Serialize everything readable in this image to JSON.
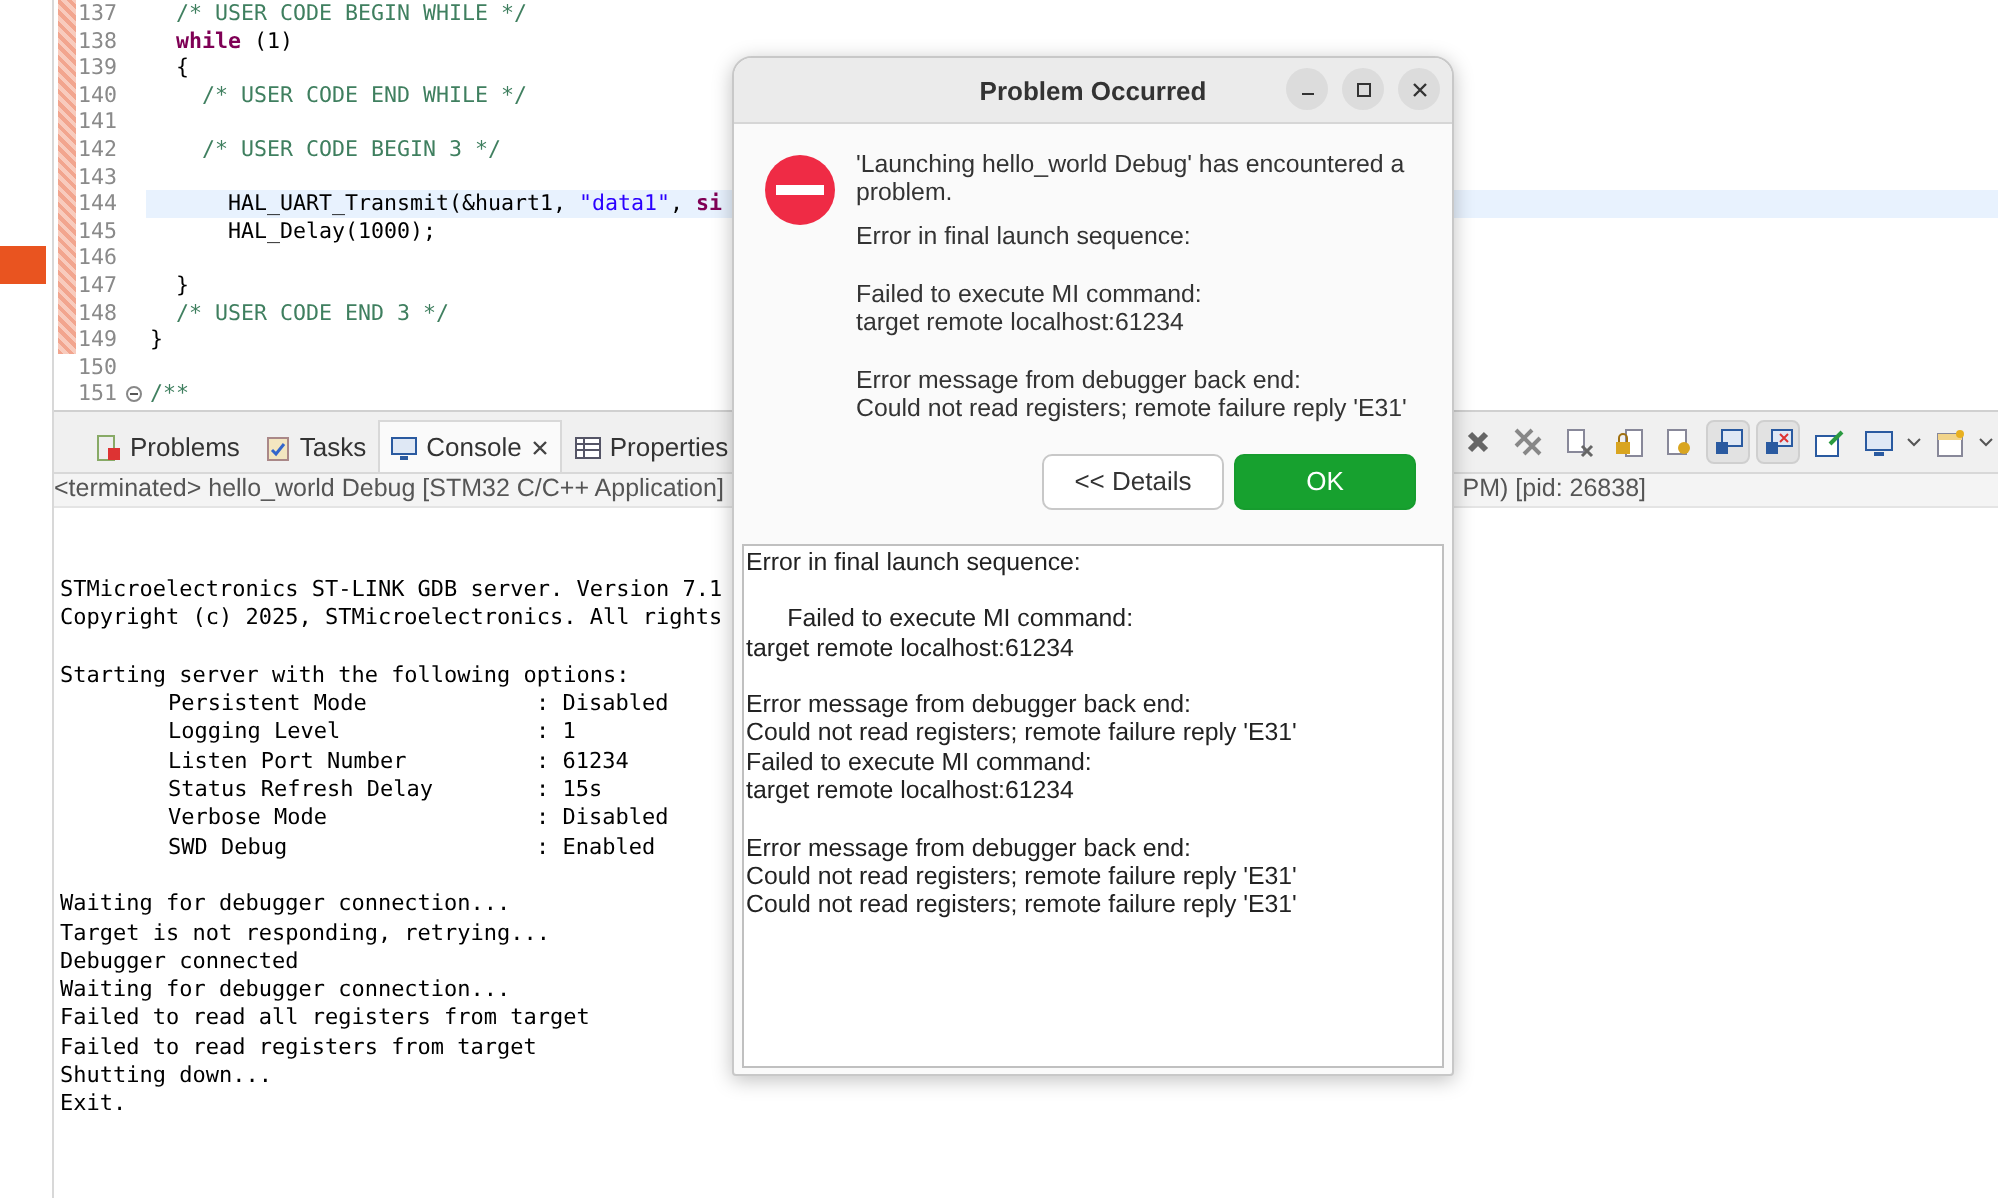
{
  "editor": {
    "lines": [
      {
        "number": "137",
        "current": false,
        "fold": false,
        "segments": [
          {
            "kind": "comment",
            "text": "  /* USER CODE BEGIN WHILE */"
          }
        ]
      },
      {
        "number": "138",
        "current": false,
        "fold": false,
        "segments": [
          {
            "kind": "keyword",
            "text": "  while"
          },
          {
            "kind": "plain",
            "text": " (1)"
          }
        ]
      },
      {
        "number": "139",
        "current": false,
        "fold": false,
        "segments": [
          {
            "kind": "plain",
            "text": "  {"
          }
        ]
      },
      {
        "number": "140",
        "current": false,
        "fold": false,
        "segments": [
          {
            "kind": "comment",
            "text": "    /* USER CODE END WHILE */"
          }
        ]
      },
      {
        "number": "141",
        "current": false,
        "fold": false
      },
      {
        "number": "142",
        "current": false,
        "fold": false,
        "segments": [
          {
            "kind": "comment",
            "text": "    /* USER CODE BEGIN 3 */"
          }
        ]
      },
      {
        "number": "143",
        "current": false,
        "fold": false
      },
      {
        "number": "144",
        "current": true,
        "fold": false,
        "segments": [
          {
            "kind": "plain",
            "text": "      HAL_UART_Transmit(&huart1, "
          },
          {
            "kind": "string",
            "text": "\"data1\""
          },
          {
            "kind": "plain",
            "text": ", "
          },
          {
            "kind": "keyword",
            "text": "si"
          }
        ]
      },
      {
        "number": "145",
        "current": false,
        "fold": false,
        "segments": [
          {
            "kind": "plain",
            "text": "      HAL_Delay(1000);"
          }
        ]
      },
      {
        "number": "146",
        "current": false,
        "fold": false
      },
      {
        "number": "147",
        "current": false,
        "fold": false,
        "segments": [
          {
            "kind": "plain",
            "text": "  }"
          }
        ]
      },
      {
        "number": "148",
        "current": false,
        "fold": false,
        "segments": [
          {
            "kind": "comment",
            "text": "  /* USER CODE END 3 */"
          }
        ]
      },
      {
        "number": "149",
        "current": false,
        "fold": false,
        "segments": [
          {
            "kind": "plain",
            "text": "}"
          }
        ]
      },
      {
        "number": "150",
        "current": false,
        "fold": false
      },
      {
        "number": "151",
        "current": false,
        "fold": true,
        "segments": [
          {
            "kind": "comment",
            "text": "/**"
          }
        ]
      }
    ]
  },
  "panel": {
    "tabs": [
      {
        "kind": "problems",
        "label": "Problems",
        "selected": false
      },
      {
        "kind": "tasks",
        "label": "Tasks",
        "selected": false
      },
      {
        "kind": "console",
        "label": "Console",
        "selected": true
      },
      {
        "kind": "properties",
        "label": "Properties",
        "selected": false
      }
    ],
    "toolbar_buttons": [
      {
        "pressed": false
      },
      {
        "pressed": false
      },
      {
        "pressed": false
      },
      {
        "pressed": false
      },
      {
        "pressed": false
      },
      {
        "pressed": true
      },
      {
        "pressed": true
      },
      {
        "pressed": false
      },
      {
        "pressed": false
      },
      {
        "pressed": false
      }
    ],
    "console_title": "<terminated> hello_world Debug [STM32 C/C++ Application]",
    "console_title_tail": "PM) [pid: 26838]",
    "console": {
      "intro": [
        "STMicroelectronics ST-LINK GDB server. Version 7.1",
        "Copyright (c) 2025, STMicroelectronics. All rights"
      ],
      "options_heading": "Starting server with the following options:",
      "options": [
        {
          "name": "Persistent Mode",
          "value": ": Disabled"
        },
        {
          "name": "Logging Level",
          "value": ": 1"
        },
        {
          "name": "Listen Port Number",
          "value": ": 61234"
        },
        {
          "name": "Status Refresh Delay",
          "value": ": 15s"
        },
        {
          "name": "Verbose Mode",
          "value": ": Disabled"
        },
        {
          "name": "SWD Debug",
          "value": ": Enabled"
        }
      ],
      "log": [
        "Waiting for debugger connection...",
        "Target is not responding, retrying...",
        "Debugger connected",
        "Waiting for debugger connection...",
        "Failed to read all registers from target",
        "Failed to read registers from target",
        "Shutting down...",
        "Exit."
      ]
    }
  },
  "dialog": {
    "title": "Problem Occurred",
    "message": "'Launching hello_world Debug' has encountered a problem.",
    "summary": "Error in final launch sequence:\n\nFailed to execute MI command:\ntarget remote localhost:61234\n\nError message from debugger back end:\nCould not read registers; remote failure reply 'E31'",
    "buttons": [
      {
        "kind": "secondary",
        "label": "<< Details"
      },
      {
        "kind": "default",
        "label": "OK"
      }
    ],
    "details": "Error in final launch sequence:\n\n      Failed to execute MI command:\ntarget remote localhost:61234\n\nError message from debugger back end:\nCould not read registers; remote failure reply 'E31'\nFailed to execute MI command:\ntarget remote localhost:61234\n\nError message from debugger back end:\nCould not read registers; remote failure reply 'E31'\nCould not read registers; remote failure reply 'E31'"
  }
}
